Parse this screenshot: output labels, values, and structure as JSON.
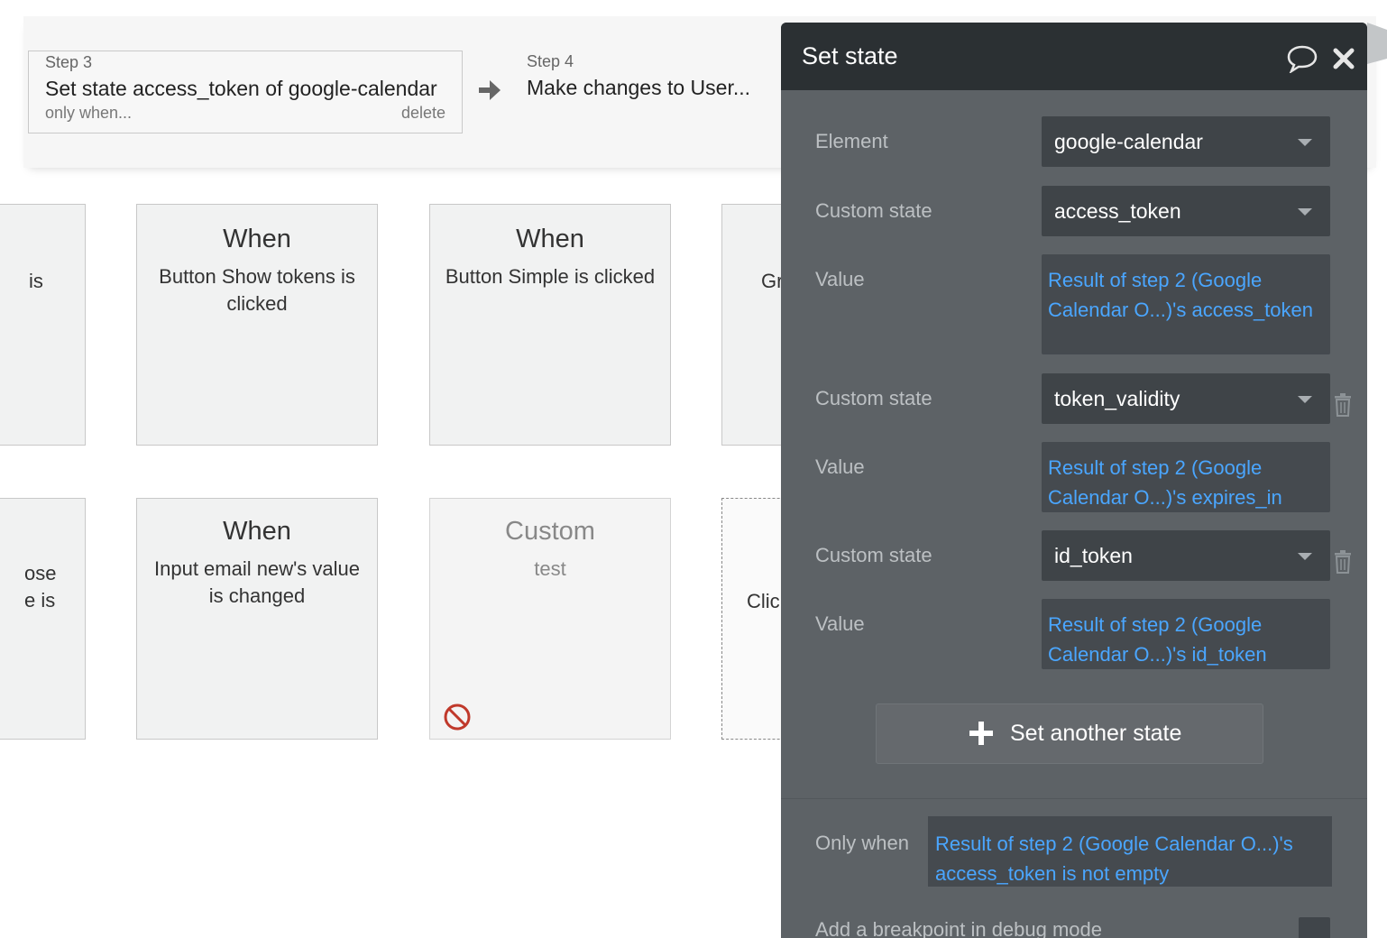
{
  "workflow_steps": {
    "step3": {
      "number_label": "Step 3",
      "title": "Set state access_token of google-calendar",
      "condition_label": "only when...",
      "delete_label": "delete"
    },
    "step4": {
      "number_label": "Step 4",
      "title": "Make changes to User..."
    }
  },
  "canvas": {
    "row1": {
      "partial_left_text": "is",
      "card1": {
        "title": "When",
        "description": "Button Show tokens is clicked"
      },
      "card2": {
        "title": "When",
        "description": "Button Simple is clicked"
      },
      "partial_right_text": "Gr"
    },
    "row2": {
      "partial_left_line1": "ose",
      "partial_left_line2": "e is",
      "card1": {
        "title": "When",
        "description": "Input email new's value is changed"
      },
      "card2": {
        "title": "Custom",
        "description": "test",
        "disabled_icon": "ban-icon"
      },
      "partial_right_text": "Clic"
    }
  },
  "panel": {
    "title": "Set state",
    "element_label": "Element",
    "element_value": "google-calendar",
    "states": [
      {
        "label": "Custom state",
        "state": "access_token",
        "value_label": "Value",
        "value": "Result of step 2 (Google Calendar O...)'s access_token"
      },
      {
        "label": "Custom state",
        "state": "token_validity",
        "value_label": "Value",
        "value": "Result of step 2 (Google Calendar O...)'s expires_in"
      },
      {
        "label": "Custom state",
        "state": "id_token",
        "value_label": "Value",
        "value": "Result of step 2 (Google Calendar O...)'s id_token"
      }
    ],
    "add_button_label": "Set another state",
    "only_when_label": "Only when",
    "only_when_value": "Result of step 2 (Google Calendar O...)'s access_token is not empty",
    "breakpoint_label": "Add a breakpoint in debug mode"
  },
  "colors": {
    "panel_bg": "#5d6266",
    "panel_header": "#2b3033",
    "expression_link": "#4aa6ff",
    "card_bg": "#f1f2f2"
  }
}
